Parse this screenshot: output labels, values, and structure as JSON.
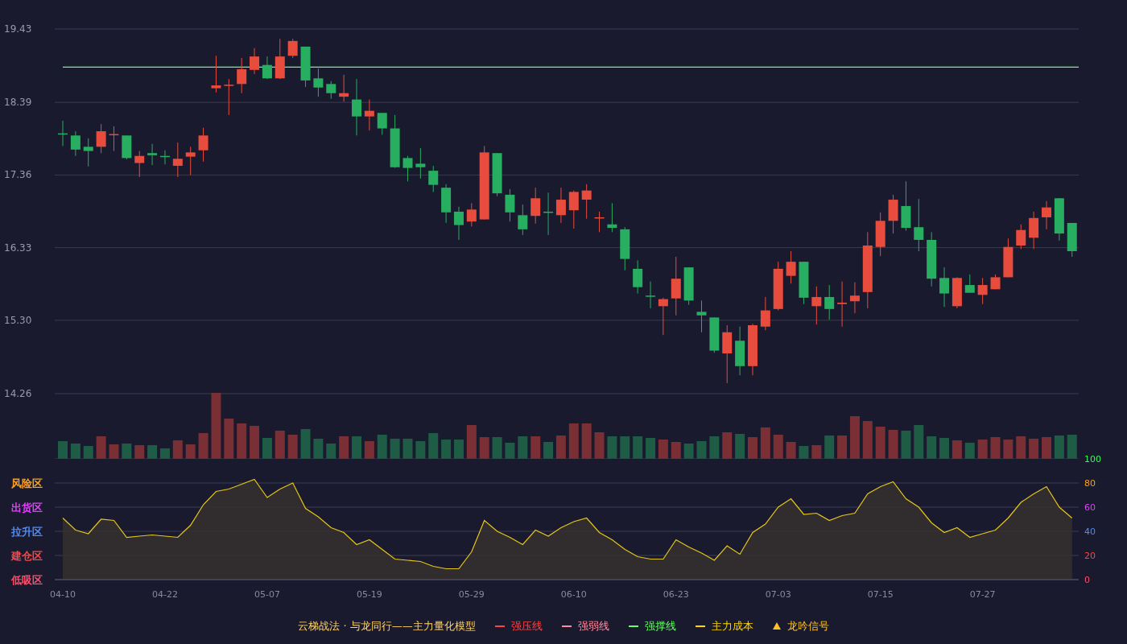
{
  "price_chart": {
    "chart_data": {
      "type": "candlestick",
      "grid": true,
      "yticks": [
        {
          "value": 19.43,
          "label": "19.43"
        },
        {
          "value": 18.39,
          "label": "18.39"
        },
        {
          "value": 17.36,
          "label": "17.36"
        },
        {
          "value": 16.33,
          "label": "16.33"
        },
        {
          "value": 15.3,
          "label": "15.30"
        },
        {
          "value": 14.26,
          "label": "14.26"
        }
      ],
      "ylim": [
        14.26,
        19.43
      ],
      "ohlc": [
        [
          17.95,
          18.13,
          17.77,
          17.94
        ],
        [
          17.92,
          17.98,
          17.63,
          17.72
        ],
        [
          17.76,
          17.88,
          17.48,
          17.7
        ],
        [
          17.76,
          18.08,
          17.67,
          17.98
        ],
        [
          17.93,
          18.05,
          17.7,
          17.94
        ],
        [
          17.92,
          17.92,
          17.58,
          17.6
        ],
        [
          17.53,
          17.7,
          17.33,
          17.63
        ],
        [
          17.67,
          17.8,
          17.5,
          17.64
        ],
        [
          17.63,
          17.71,
          17.51,
          17.62
        ],
        [
          17.49,
          17.82,
          17.33,
          17.59
        ],
        [
          17.62,
          17.76,
          17.36,
          17.68
        ],
        [
          17.71,
          18.03,
          17.55,
          17.92
        ],
        [
          18.59,
          19.05,
          18.53,
          18.63
        ],
        [
          18.63,
          18.72,
          18.21,
          18.64
        ],
        [
          18.65,
          19.02,
          18.52,
          18.86
        ],
        [
          18.85,
          19.16,
          18.79,
          19.04
        ],
        [
          18.92,
          19.04,
          18.72,
          18.73
        ],
        [
          18.73,
          19.29,
          18.72,
          19.04
        ],
        [
          19.05,
          19.29,
          19.02,
          19.26
        ],
        [
          19.18,
          19.18,
          18.61,
          18.7
        ],
        [
          18.73,
          18.87,
          18.47,
          18.6
        ],
        [
          18.65,
          18.69,
          18.44,
          18.52
        ],
        [
          18.47,
          18.78,
          18.4,
          18.52
        ],
        [
          18.43,
          18.72,
          17.92,
          18.19
        ],
        [
          18.19,
          18.43,
          17.99,
          18.27
        ],
        [
          18.24,
          18.24,
          17.93,
          18.02
        ],
        [
          18.02,
          18.21,
          17.46,
          17.47
        ],
        [
          17.6,
          17.63,
          17.27,
          17.46
        ],
        [
          17.52,
          17.74,
          17.31,
          17.47
        ],
        [
          17.42,
          17.49,
          17.12,
          17.22
        ],
        [
          17.18,
          17.23,
          16.68,
          16.83
        ],
        [
          16.84,
          16.91,
          16.44,
          16.65
        ],
        [
          16.7,
          16.96,
          16.63,
          16.87
        ],
        [
          16.73,
          17.77,
          16.73,
          17.68
        ],
        [
          17.67,
          17.67,
          17.06,
          17.1
        ],
        [
          17.08,
          17.16,
          16.7,
          16.83
        ],
        [
          16.79,
          16.94,
          16.51,
          16.59
        ],
        [
          16.78,
          17.18,
          16.67,
          17.03
        ],
        [
          16.84,
          17.11,
          16.51,
          16.83
        ],
        [
          16.79,
          17.18,
          16.68,
          17.01
        ],
        [
          16.86,
          17.14,
          16.6,
          17.12
        ],
        [
          17.01,
          17.23,
          16.74,
          17.14
        ],
        [
          16.75,
          16.84,
          16.55,
          16.76
        ],
        [
          16.66,
          16.96,
          16.55,
          16.61
        ],
        [
          16.59,
          16.62,
          16.01,
          16.17
        ],
        [
          16.03,
          16.15,
          15.68,
          15.77
        ],
        [
          15.65,
          15.85,
          15.47,
          15.64
        ],
        [
          15.5,
          15.62,
          15.09,
          15.6
        ],
        [
          15.61,
          16.2,
          15.37,
          15.89
        ],
        [
          16.05,
          16.05,
          15.52,
          15.58
        ],
        [
          15.42,
          15.58,
          15.13,
          15.37
        ],
        [
          15.34,
          15.34,
          14.84,
          14.87
        ],
        [
          14.83,
          15.23,
          14.41,
          15.13
        ],
        [
          15.01,
          15.21,
          14.52,
          14.65
        ],
        [
          14.65,
          15.25,
          14.52,
          15.23
        ],
        [
          15.21,
          15.63,
          15.16,
          15.44
        ],
        [
          15.46,
          16.13,
          15.44,
          16.03
        ],
        [
          15.93,
          16.28,
          15.82,
          16.13
        ],
        [
          16.13,
          16.13,
          15.53,
          15.62
        ],
        [
          15.5,
          15.78,
          15.24,
          15.63
        ],
        [
          15.63,
          15.8,
          15.31,
          15.46
        ],
        [
          15.53,
          15.85,
          15.21,
          15.55
        ],
        [
          15.57,
          15.84,
          15.4,
          15.65
        ],
        [
          15.7,
          16.55,
          15.47,
          16.36
        ],
        [
          16.34,
          16.83,
          16.21,
          16.71
        ],
        [
          16.71,
          17.08,
          16.53,
          17.01
        ],
        [
          16.92,
          17.27,
          16.57,
          16.61
        ],
        [
          16.62,
          17.02,
          16.28,
          16.44
        ],
        [
          16.44,
          16.55,
          15.78,
          15.89
        ],
        [
          15.9,
          16.05,
          15.49,
          15.68
        ],
        [
          15.5,
          15.91,
          15.47,
          15.9
        ],
        [
          15.8,
          15.95,
          15.69,
          15.69
        ],
        [
          15.66,
          15.9,
          15.53,
          15.8
        ],
        [
          15.74,
          15.95,
          15.74,
          15.91
        ],
        [
          15.91,
          16.46,
          15.91,
          16.34
        ],
        [
          16.36,
          16.66,
          16.31,
          16.58
        ],
        [
          16.47,
          16.84,
          16.31,
          16.75
        ],
        [
          16.76,
          16.99,
          16.59,
          16.9
        ],
        [
          17.03,
          17.03,
          16.43,
          16.53
        ],
        [
          16.68,
          16.68,
          16.2,
          16.28
        ]
      ],
      "ref_lines": [
        {
          "axis": "y",
          "value": 18.89,
          "color": "#66ff66"
        }
      ]
    }
  },
  "indicator_chart": {
    "zones": [
      {
        "label": "风险区",
        "color": "#ff9f1a"
      },
      {
        "label": "出货区",
        "color": "#e040fb"
      },
      {
        "label": "拉升区",
        "color": "#4a8cff"
      },
      {
        "label": "建仓区",
        "color": "#ff4444"
      },
      {
        "label": "低吸区",
        "color": "#ff4d6a"
      }
    ],
    "x_labels": [
      "04-10",
      "04-22",
      "05-07",
      "05-19",
      "05-29",
      "06-10",
      "06-23",
      "07-03",
      "07-15",
      "07-27"
    ],
    "chart_data": {
      "type": "area",
      "grid": true,
      "ylim": [
        0,
        100
      ],
      "yticks": [
        {
          "value": 100,
          "label": "100"
        },
        {
          "value": 80,
          "label": "80"
        },
        {
          "value": 60,
          "label": "60"
        },
        {
          "value": 40,
          "label": "40"
        },
        {
          "value": 20,
          "label": "20"
        },
        {
          "value": 0,
          "label": "0"
        }
      ],
      "series": [
        {
          "color": "#e6c619",
          "values": [
            51,
            41,
            38,
            50,
            49,
            35,
            36,
            37,
            36,
            35,
            45,
            62,
            73,
            75,
            79,
            83,
            68,
            75,
            80,
            59,
            52,
            43,
            39,
            29,
            33,
            25,
            17,
            16,
            15,
            11,
            9,
            9,
            23,
            49,
            40,
            35,
            29,
            41,
            36,
            43,
            48,
            51,
            39,
            33,
            25,
            19,
            17,
            17,
            33,
            27,
            22,
            16,
            28,
            21,
            39,
            46,
            60,
            67,
            54,
            55,
            49,
            53,
            55,
            71,
            77,
            81,
            67,
            60,
            47,
            39,
            43,
            35,
            38,
            41,
            51,
            64,
            71,
            77,
            60,
            51
          ]
        }
      ]
    }
  },
  "legend": {
    "title": "云梯战法 · 与龙同行——主力量化模型",
    "items": [
      {
        "kind": "solid",
        "label": "强压线",
        "color": "#ff4444"
      },
      {
        "kind": "dashed",
        "label": "强弱线",
        "color": "#ff8fa3"
      },
      {
        "kind": "solid",
        "label": "强撑线",
        "color": "#66ff66"
      },
      {
        "kind": "dashed",
        "label": "主力成本",
        "color": "#ffd700"
      },
      {
        "kind": "triangle",
        "label": "龙吟信号",
        "color": "#ffc125"
      }
    ]
  }
}
